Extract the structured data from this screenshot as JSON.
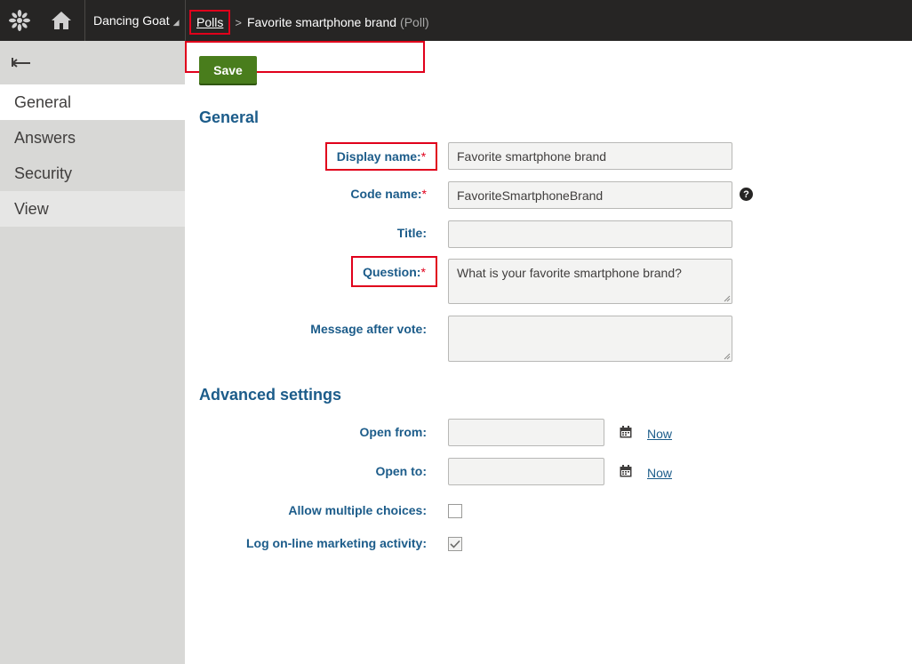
{
  "topbar": {
    "site_name": "Dancing Goat",
    "breadcrumb_link": "Polls",
    "breadcrumb_current": "Favorite smartphone brand",
    "breadcrumb_type": "(Poll)"
  },
  "icons": {
    "logo": "kentico-logo-icon",
    "home": "home-icon",
    "site_caret": "caret-down-icon",
    "back": "back-arrow-icon",
    "help": "question-circle-icon",
    "calendar": "calendar-icon",
    "check": "checkmark-icon"
  },
  "leftnav": {
    "items": [
      {
        "label": "General",
        "active": true
      },
      {
        "label": "Answers",
        "active": false
      },
      {
        "label": "Security",
        "active": false
      },
      {
        "label": "View",
        "active": false
      }
    ]
  },
  "main": {
    "save_label": "Save",
    "general_title": "General",
    "advanced_title": "Advanced settings"
  },
  "form": {
    "display_name": {
      "label": "Display name:",
      "required_mark": "*",
      "value": "Favorite smartphone brand"
    },
    "code_name": {
      "label": "Code name:",
      "required_mark": "*",
      "value": "FavoriteSmartphoneBrand"
    },
    "title": {
      "label": "Title:",
      "value": ""
    },
    "question": {
      "label": "Question:",
      "required_mark": "*",
      "value": "What is your favorite smartphone brand?"
    },
    "message_after_vote": {
      "label": "Message after vote:",
      "value": ""
    },
    "open_from": {
      "label": "Open from:",
      "value": "",
      "now_label": "Now"
    },
    "open_to": {
      "label": "Open to:",
      "value": "",
      "now_label": "Now"
    },
    "allow_multiple": {
      "label": "Allow multiple choices:",
      "checked": false
    },
    "log_activity": {
      "label": "Log on-line marketing activity:",
      "checked": true
    }
  },
  "colors": {
    "topbar_bg": "#262524",
    "leftnav_bg": "#d8d8d6",
    "save_green": "#497d1c",
    "label_blue": "#1c5c8a",
    "highlight_red": "#e0001b"
  }
}
